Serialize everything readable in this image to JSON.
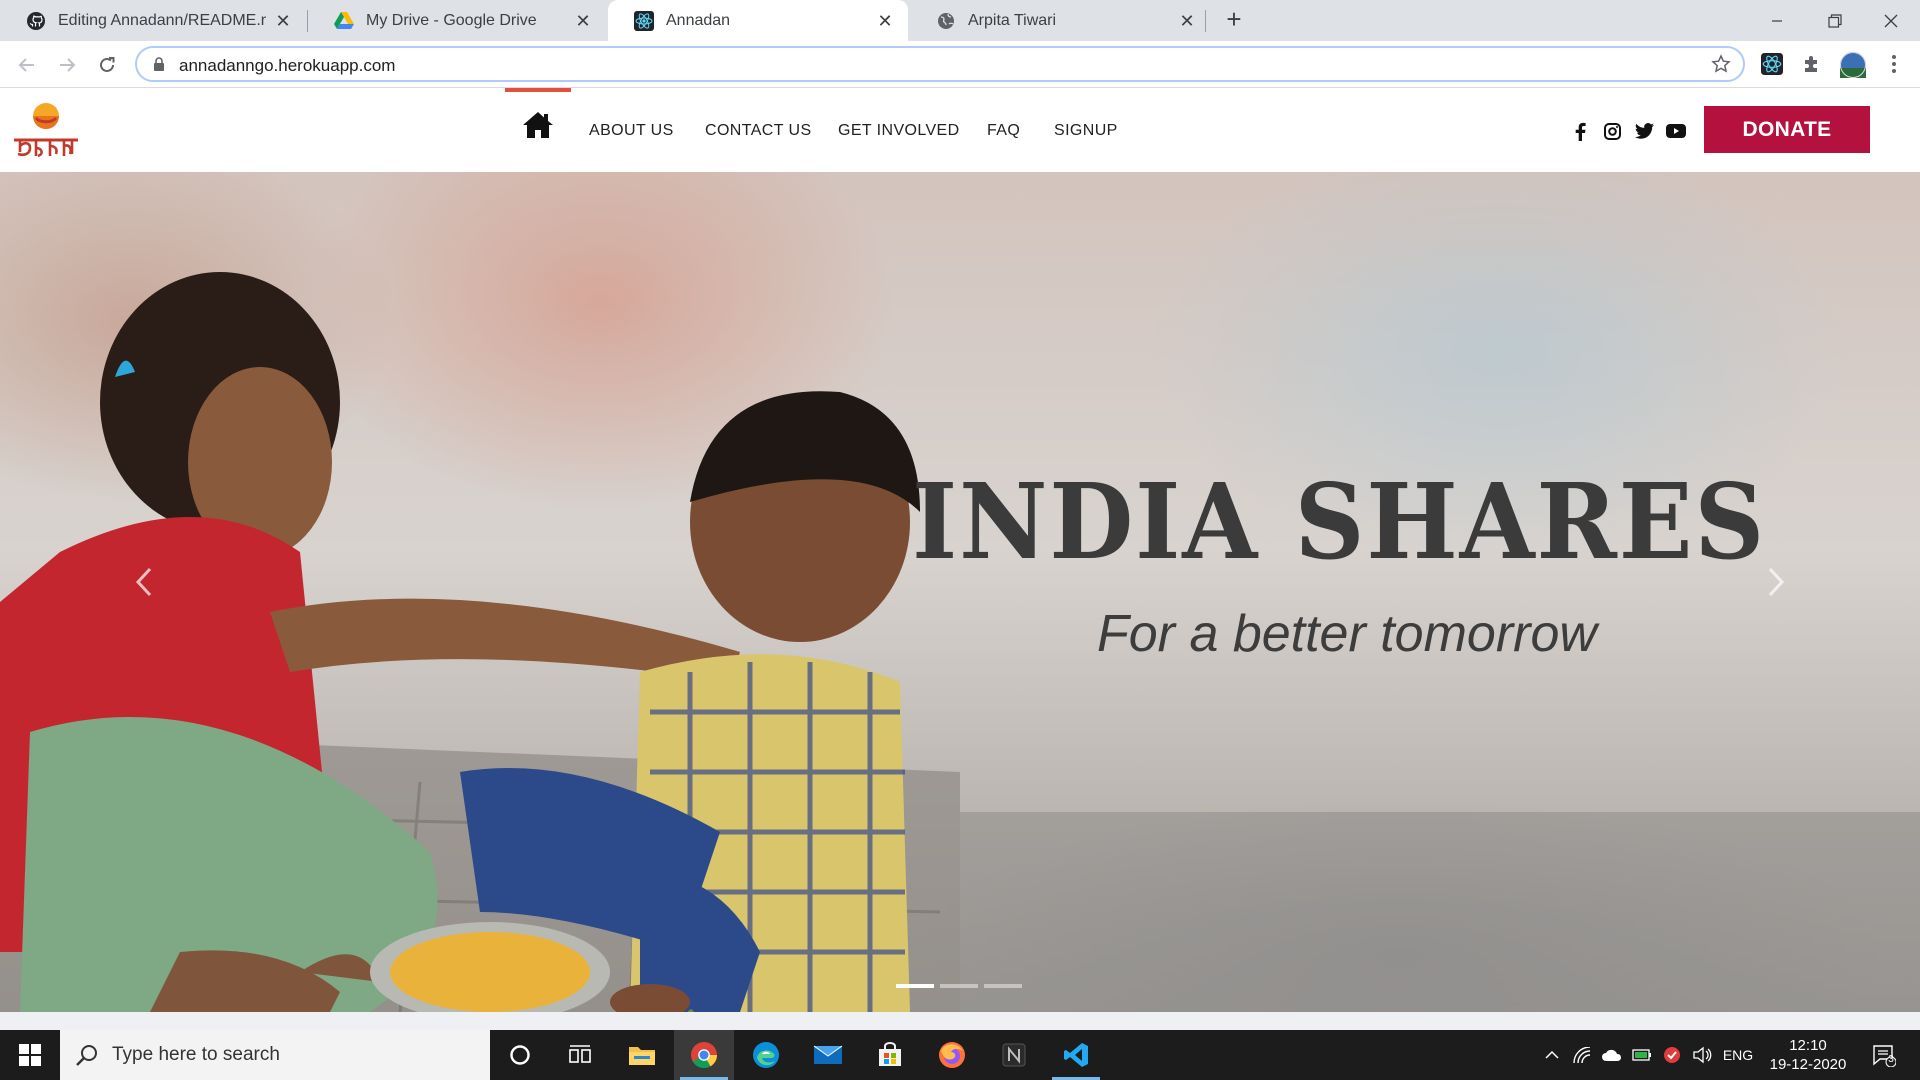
{
  "browser": {
    "tabs": [
      {
        "title": "Editing Annadann/README.md a",
        "favicon": "github-icon"
      },
      {
        "title": "My Drive - Google Drive",
        "favicon": "google-drive-icon"
      },
      {
        "title": "Annadan",
        "favicon": "react-icon",
        "active": true
      },
      {
        "title": "Arpita Tiwari",
        "favicon": "globe-icon"
      }
    ],
    "tab_close_glyph": "✕",
    "new_tab_glyph": "+",
    "address_bar": {
      "url": "annadanngo.herokuapp.com"
    }
  },
  "site": {
    "brand_color": "#b5113e",
    "nav": {
      "links": [
        "ABOUT US",
        "CONTACT US",
        "GET INVOLVED",
        "FAQ",
        "SIGNUP"
      ]
    },
    "donate_label": "DONATE",
    "social": [
      "facebook-icon",
      "instagram-icon",
      "twitter-icon",
      "youtube-icon"
    ],
    "hero": {
      "title": "INDIA SHARES",
      "subtitle": "For a better tomorrow",
      "slide_count": 3,
      "active_slide": 1
    }
  },
  "taskbar": {
    "search_placeholder": "Type here to search",
    "language": "ENG",
    "time": "12:10",
    "date": "19-12-2020",
    "notification_count": "3"
  }
}
